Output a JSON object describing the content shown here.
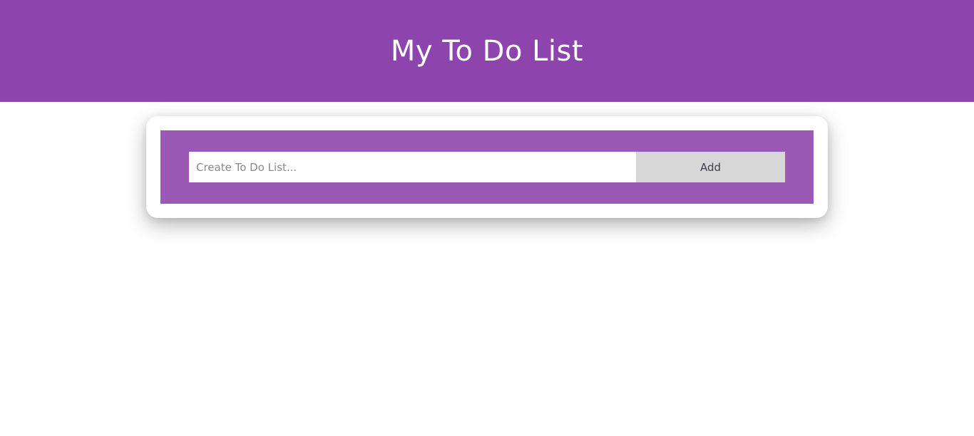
{
  "header": {
    "title": "My To Do List"
  },
  "todo_form": {
    "input_value": "",
    "input_placeholder": "Create To Do List...",
    "add_label": "Add"
  },
  "colors": {
    "header_background": "#8e44ad",
    "form_background": "#9b59b6",
    "button_background": "#d7d7d7",
    "page_background": "#ffffff"
  }
}
